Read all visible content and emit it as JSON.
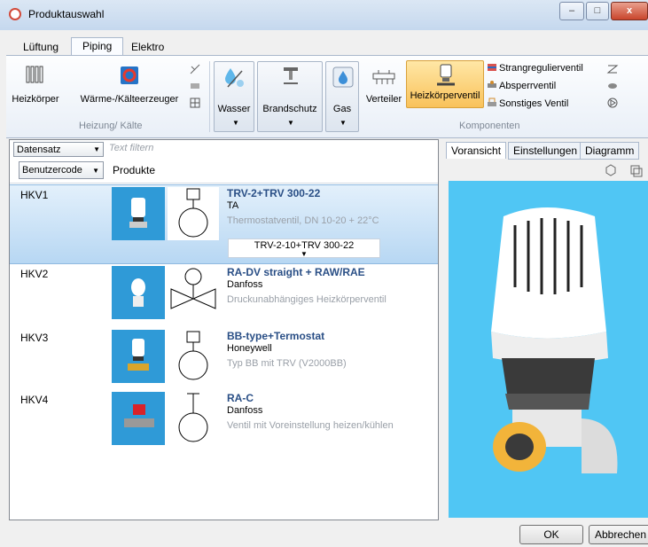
{
  "window": {
    "title": "Produktauswahl",
    "controls": {
      "minimize": "–",
      "maximize": "□",
      "close": "x"
    }
  },
  "tabs": [
    {
      "label": "Lüftung"
    },
    {
      "label": "Piping"
    },
    {
      "label": "Elektro"
    }
  ],
  "ribbon": {
    "heizung": {
      "heizkoerper": "Heizkörper",
      "waerme": "Wärme-/Kälteerzeuger",
      "group": "Heizung/ Kälte"
    },
    "wasser": "Wasser",
    "brandschutz": "Brandschutz",
    "gas": "Gas",
    "komponenten": {
      "verteiler": "Verteiler",
      "heizkoerperventil": "Heizkörperventil",
      "strangregulierventil": "Strangregulierventil",
      "absperrventil": "Absperrventil",
      "sonstiges": "Sonstiges Ventil",
      "group": "Komponenten"
    }
  },
  "filter": {
    "datensatz": "Datensatz",
    "placeholder": "Text filtern"
  },
  "columns": {
    "code_combo": "Benutzercode",
    "products": "Produkte"
  },
  "rows": [
    {
      "code": "HKV1",
      "name": "TRV-2+TRV 300-22",
      "manufacturer": "TA",
      "description": "Thermostatventil, DN 10-20 + 22°C",
      "variant": "TRV-2-10+TRV 300-22"
    },
    {
      "code": "HKV2",
      "name": "RA-DV straight + RAW/RAE",
      "manufacturer": "Danfoss",
      "description": "Druckunabhängiges Heizkörperventil"
    },
    {
      "code": "HKV3",
      "name": "BB-type+Termostat",
      "manufacturer": "Honeywell",
      "description": "Typ BB mit TRV (V2000BB)"
    },
    {
      "code": "HKV4",
      "name": "RA-C",
      "manufacturer": "Danfoss",
      "description": "Ventil mit Voreinstellung heizen/kühlen"
    }
  ],
  "right_tabs": [
    {
      "label": "Voransicht"
    },
    {
      "label": "Einstellungen"
    },
    {
      "label": "Diagramm"
    }
  ],
  "buttons": {
    "ok": "OK",
    "cancel": "Abbrechen"
  },
  "colors": {
    "preview_bg": "#50c6f4",
    "thumb_bg": "#2f9ad7",
    "highlight": "#f9c25a",
    "product_name": "#2a4f86"
  }
}
